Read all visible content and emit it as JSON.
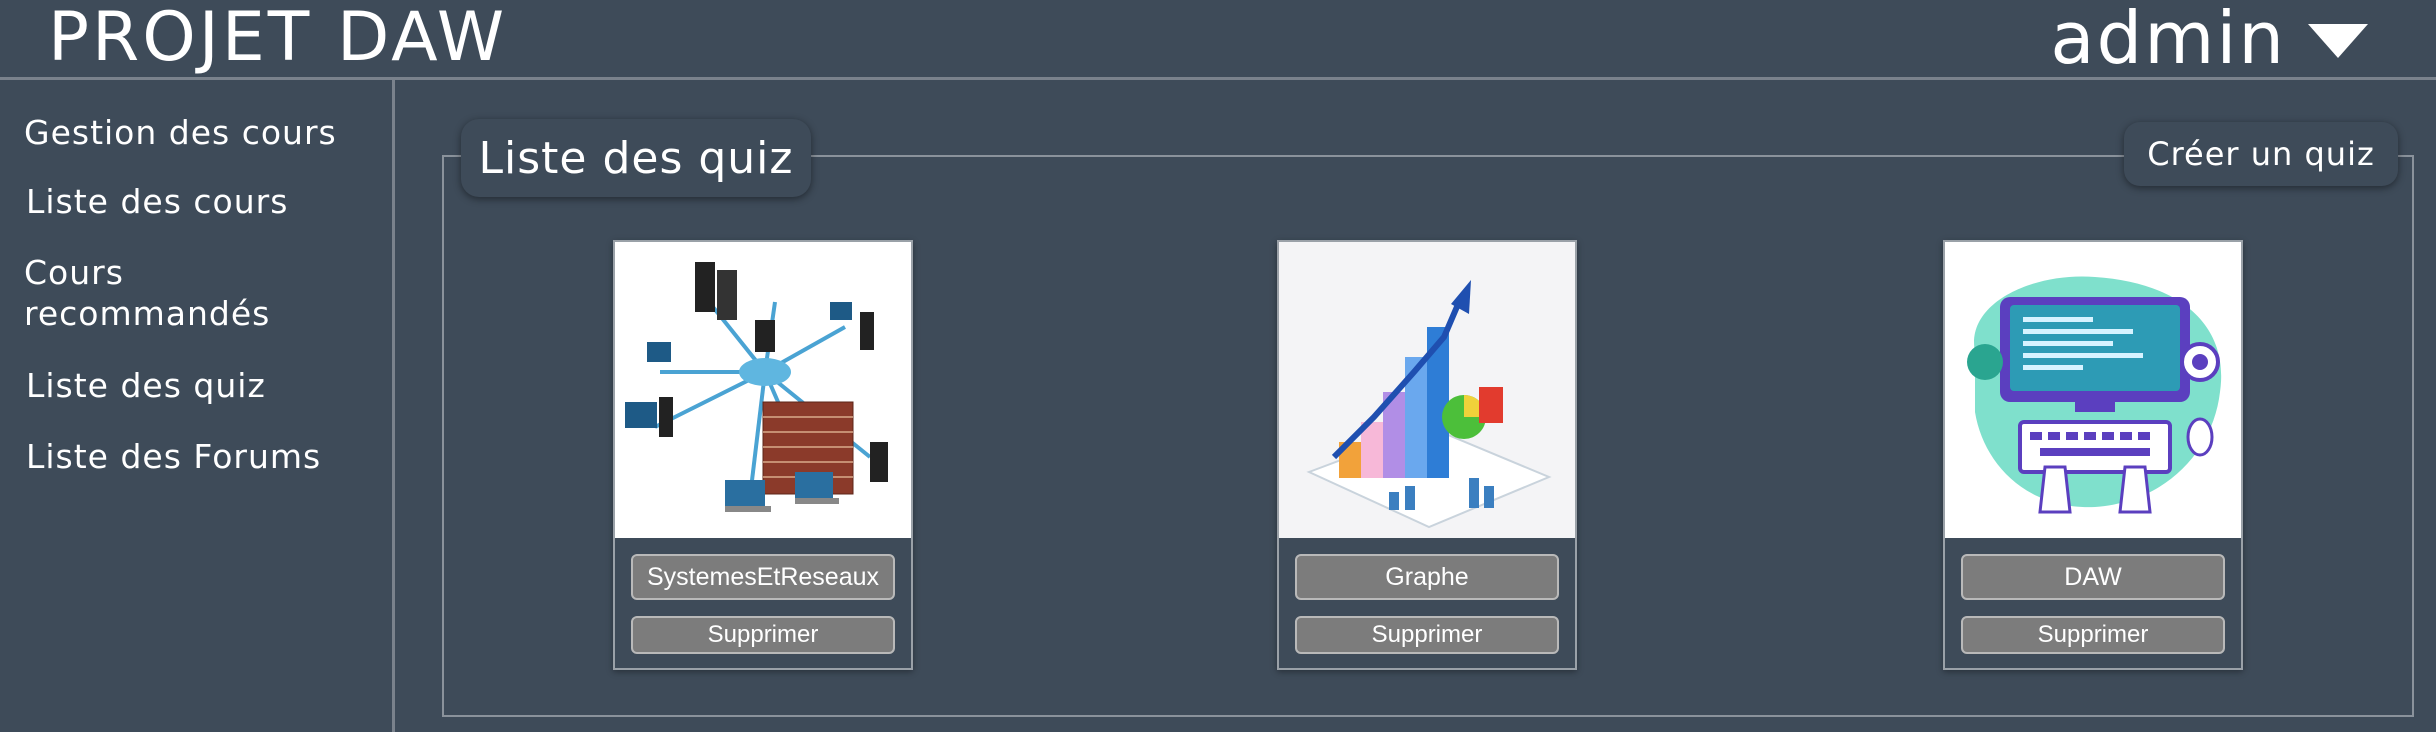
{
  "header": {
    "brand": "PROJET DAW",
    "user": "admin",
    "user_menu_icon": "caret-down-icon"
  },
  "sidebar": {
    "items": [
      {
        "label": "Gestion des cours"
      },
      {
        "label": "Liste des cours"
      },
      {
        "label": "Cours recommandés"
      },
      {
        "label": "Liste des quiz"
      },
      {
        "label": "Liste des Forums"
      }
    ]
  },
  "main": {
    "title": "Liste des quiz",
    "create_label": "Créer un quiz",
    "quizzes": [
      {
        "name": "SystemesEtReseaux",
        "delete_label": "Supprimer",
        "image": "network-firewall-illustration"
      },
      {
        "name": "Graphe",
        "delete_label": "Supprimer",
        "image": "bar-chart-growth-illustration"
      },
      {
        "name": "DAW",
        "delete_label": "Supprimer",
        "image": "web-developer-keyboard-illustration"
      }
    ]
  },
  "colors": {
    "background": "#3e4b59",
    "divider": "#7a828c",
    "button": "#7c7c7c",
    "text": "#ffffff"
  }
}
